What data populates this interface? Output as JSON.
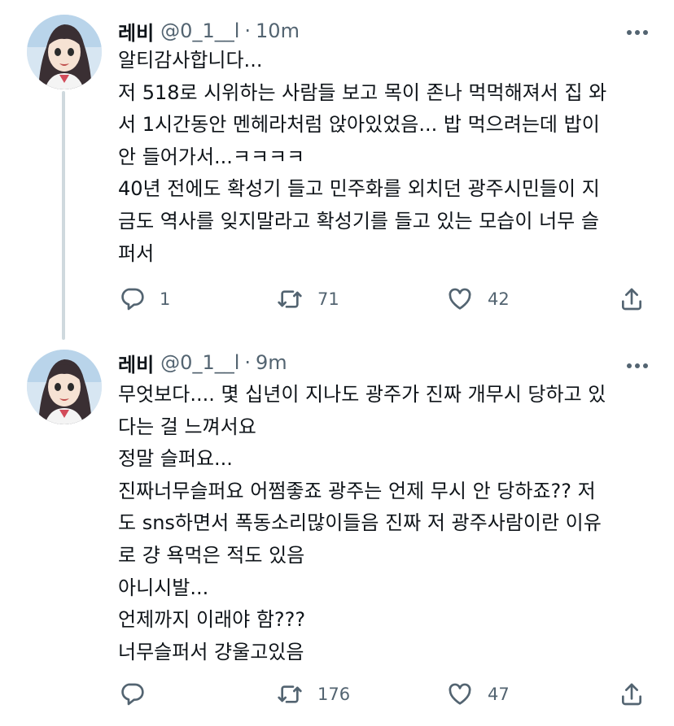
{
  "tweets": [
    {
      "display_name": "레비",
      "handle": "@0_1__l",
      "separator": "·",
      "time": "10m",
      "lines": [
        "알티감사합니다...",
        "저 518로 시위하는 사람들 보고 목이 존나 먹먹해져서 집 와",
        "서 1시간동안 멘헤라처럼 앉아있었음... 밥 먹으려는데 밥이",
        "안 들어가서...ㅋㅋㅋㅋ",
        "40년 전에도 확성기 들고 민주화를 외치던 광주시민들이 지",
        "금도 역사를 잊지말라고 확성기를 들고 있는 모습이 너무 슬",
        "퍼서"
      ],
      "replies": "1",
      "retweets": "71",
      "likes": "42"
    },
    {
      "display_name": "레비",
      "handle": "@0_1__l",
      "separator": "·",
      "time": "9m",
      "lines": [
        "무엇보다.... 몇 십년이 지나도 광주가 진짜 개무시 당하고 있",
        "다는 걸 느껴서요",
        "정말 슬퍼요...",
        "진짜너무슬퍼요 어쩜좋죠 광주는 언제 무시 안 당하죠?? 저",
        "도 sns하면서 폭동소리많이들음 진짜 저 광주사람이란 이유",
        "로 걍 욕먹은 적도 있음",
        "아니시발...",
        "언제까지 이래야 함???",
        "너무슬퍼서 걍울고있음"
      ],
      "replies": "",
      "retweets": "176",
      "likes": "47"
    }
  ],
  "icons": {
    "reply": "reply-icon",
    "retweet": "retweet-icon",
    "like": "heart-icon",
    "share": "share-icon",
    "more": "more-icon"
  }
}
